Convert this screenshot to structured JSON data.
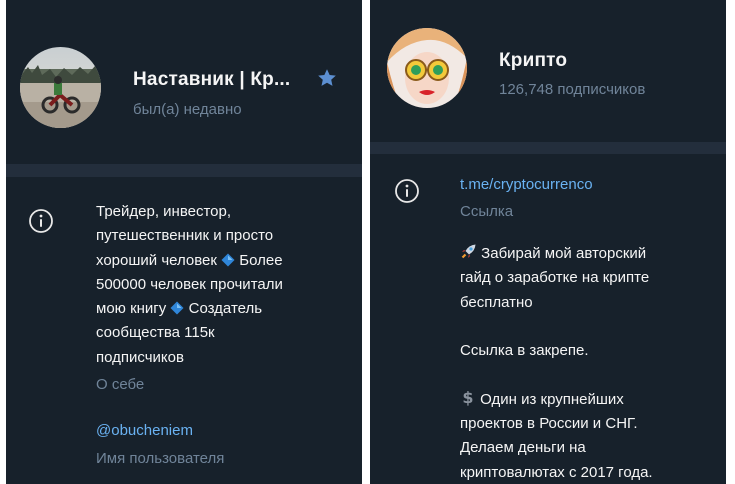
{
  "left": {
    "title": "Наставник | Кр...",
    "status": "был(а) недавно",
    "bio_lines": [
      "Трейдер, инвестор,",
      "путешественник и просто",
      "хороший человек",
      "Более",
      "500000 человек прочитали",
      "мою книгу",
      "Создатель",
      "сообщества 115к",
      "подписчиков"
    ],
    "bio_caption": "О себе",
    "username": "@obucheniem",
    "username_caption": "Имя пользователя",
    "icons": {
      "verified": "star-icon",
      "info": "info-icon",
      "bullet": "blue-diamond-icon"
    }
  },
  "right": {
    "title": "Крипто",
    "subscribers": "126,748 подписчиков",
    "link": "t.me/cryptocurrenco",
    "link_caption": "Ссылка",
    "desc_lines": [
      "Забирай мой авторский",
      "гайд о заработке на крипте",
      "бесплатно",
      "",
      "Ссылка в закрепе.",
      "",
      "Один из крупнейших",
      "проектов в России и СНГ.",
      "Делаем деньги на",
      "криптовалютах с 2017 года."
    ],
    "icons": {
      "info": "info-icon",
      "rocket": "rocket-icon",
      "dollar": "dollar-icon"
    }
  },
  "colors": {
    "panel_bg": "#17212b",
    "separator": "#232e3c",
    "text": "#f5f5f5",
    "secondary": "#708499",
    "link": "#6ab2f2",
    "diamond": "#2f86d9"
  }
}
